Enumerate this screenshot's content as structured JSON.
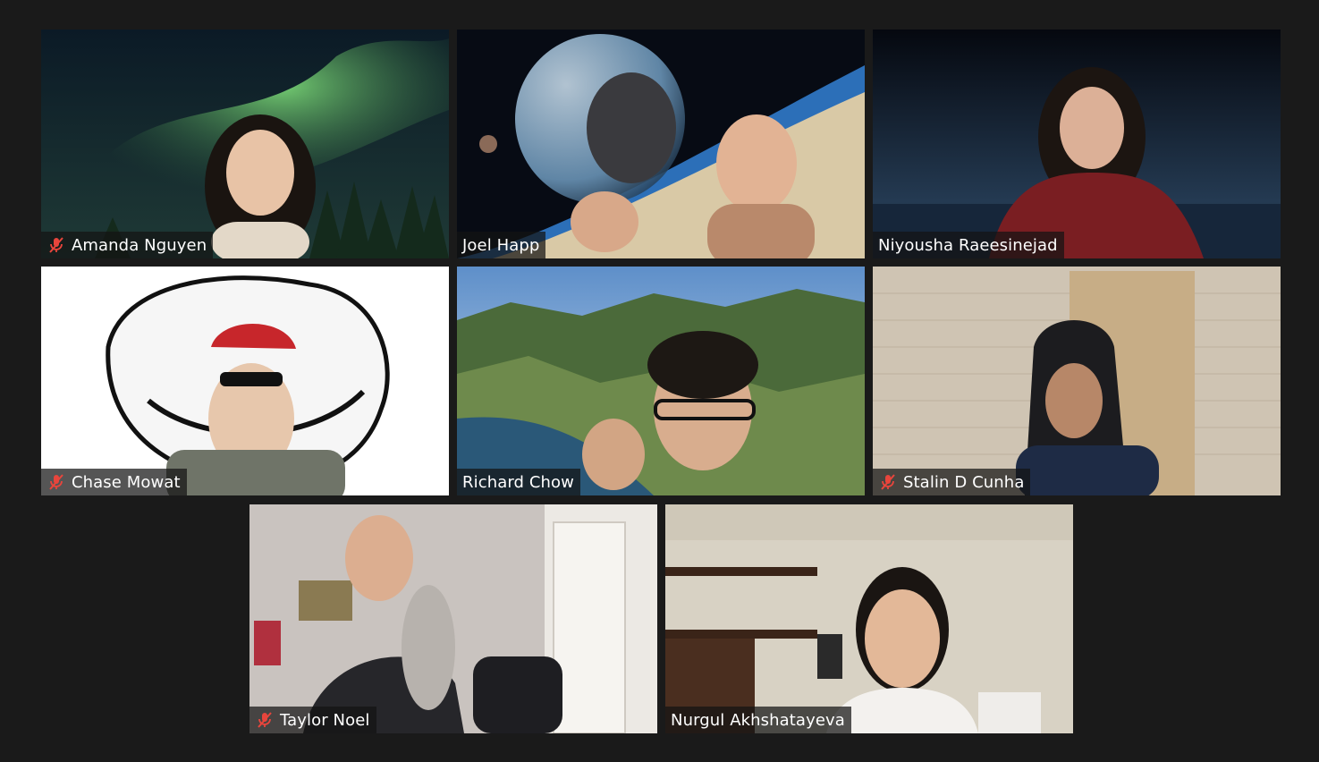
{
  "participants": [
    {
      "name": "Amanda Nguyen",
      "muted": true
    },
    {
      "name": "Joel Happ",
      "muted": false
    },
    {
      "name": "Niyousha Raeesinejad",
      "muted": false
    },
    {
      "name": "Chase Mowat",
      "muted": true
    },
    {
      "name": "Richard Chow",
      "muted": false
    },
    {
      "name": "Stalin D Cunha",
      "muted": true
    },
    {
      "name": "Taylor Noel",
      "muted": true
    },
    {
      "name": "Nurgul Akhshatayeva",
      "muted": false
    }
  ],
  "colors": {
    "background": "#1a1a1a",
    "muted_icon": "#e8453c",
    "nametag_text": "#ffffff"
  },
  "icons": {
    "muted": "mic-off-icon"
  }
}
